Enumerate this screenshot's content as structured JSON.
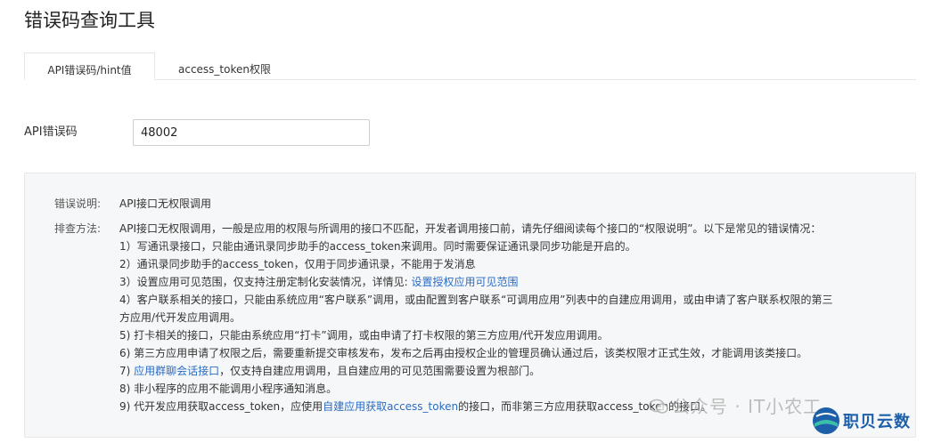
{
  "page": {
    "title": "错误码查询工具"
  },
  "tabs": [
    {
      "label": "API错误码/hint值",
      "active": true
    },
    {
      "label": "access_token权限",
      "active": false
    }
  ],
  "query": {
    "label": "API错误码",
    "value": "48002"
  },
  "result": {
    "desc_label": "错误说明:",
    "desc_value": "API接口无权限调用",
    "check_label": "排查方法:",
    "intro": "API接口无权限调用，一般是应用的权限与所调用的接口不匹配，开发者调用接口前，请先仔细阅读每个接口的“权限说明”。以下是常见的错误情况：",
    "item1": "1）写通讯录接口，只能由通讯录同步助手的access_token来调用。同时需要保证通讯录同步功能是开启的。",
    "item2": "2）通讯录同步助手的access_token，仅用于同步通讯录，不能用于发消息",
    "item3_pre": "3）设置应用可见范围，仅支持注册定制化安装情况，详情见: ",
    "item3_link": "设置授权应用可见范围",
    "item4_line1": "4）客户联系相关的接口，只能由系统应用“客户联系”调用，或由配置到客户联系“可调用应用”列表中的自建应用调用，或由申请了客户联系权限的第三",
    "item4_line2": "方应用/代开发应用调用。",
    "item5": "5) 打卡相关的接口，只能由系统应用“打卡”调用，或由申请了打卡权限的第三方应用/代开发应用调用。",
    "item6": "6) 第三方应用申请了权限之后，需要重新提交审核发布，发布之后再由授权企业的管理员确认通过后，该类权限才正式生效，才能调用该类接口。",
    "item7_pre": "7) ",
    "item7_link": "应用群聊会话接口",
    "item7_post": "，仅支持自建应用调用，且自建应用的可见范围需要设置为根部门。",
    "item8": "8) 非小程序的应用不能调用小程序通知消息。",
    "item9_pre": "9) 代开发应用获取access_token，应使用",
    "item9_link": "自建应用获取access_token",
    "item9_post": "的接口，而非第三方应用获取access_token的接口。"
  },
  "watermark": {
    "text": "公众号 · IT小农工"
  },
  "brand": {
    "name": "职贝云数"
  },
  "colors": {
    "link": "#2b6cc4",
    "panel_bg": "#f6f7f8",
    "brand": "#1d5fa8"
  }
}
